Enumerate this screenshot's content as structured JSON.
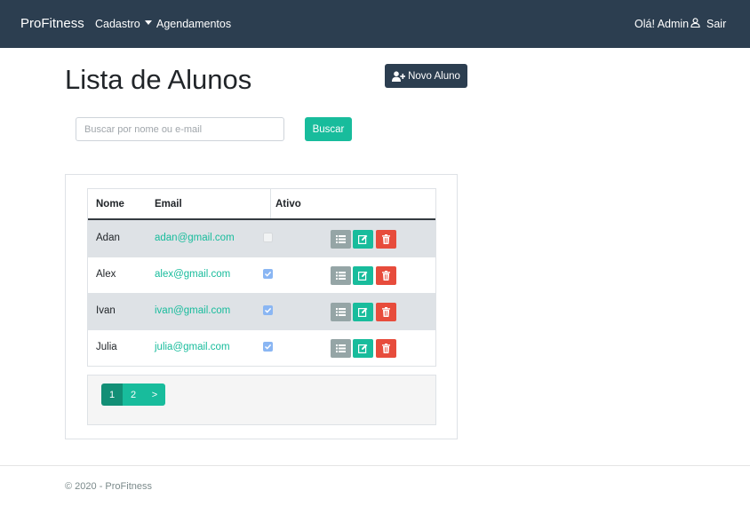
{
  "navbar": {
    "brand": "ProFitness",
    "cadastro": "Cadastro",
    "agendamentos": "Agendamentos",
    "greeting": "Olá! Admin",
    "logout": "Sair"
  },
  "page": {
    "title": "Lista de Alunos",
    "new_button": "Novo Aluno"
  },
  "search": {
    "placeholder": "Buscar por nome ou e-mail",
    "value": "",
    "button": "Buscar"
  },
  "table": {
    "headers": {
      "name": "Nome",
      "email": "Email",
      "active": "Ativo"
    },
    "rows": [
      {
        "name": "Adan",
        "email": "adan@gmail.com",
        "active": false
      },
      {
        "name": "Alex",
        "email": "alex@gmail.com",
        "active": true
      },
      {
        "name": "Ivan",
        "email": "ivan@gmail.com",
        "active": true
      },
      {
        "name": "Julia",
        "email": "julia@gmail.com",
        "active": true
      }
    ],
    "action_icons": [
      "list-icon",
      "edit-icon",
      "trash-icon"
    ]
  },
  "pagination": {
    "pages": [
      "1",
      "2"
    ],
    "next": ">",
    "current": 1
  },
  "footer": {
    "text": "© 2020 - ProFitness"
  },
  "colors": {
    "navbar": "#2c3e50",
    "accent": "#18bc9c",
    "danger": "#e74c3c",
    "secondary": "#95a5a6"
  }
}
